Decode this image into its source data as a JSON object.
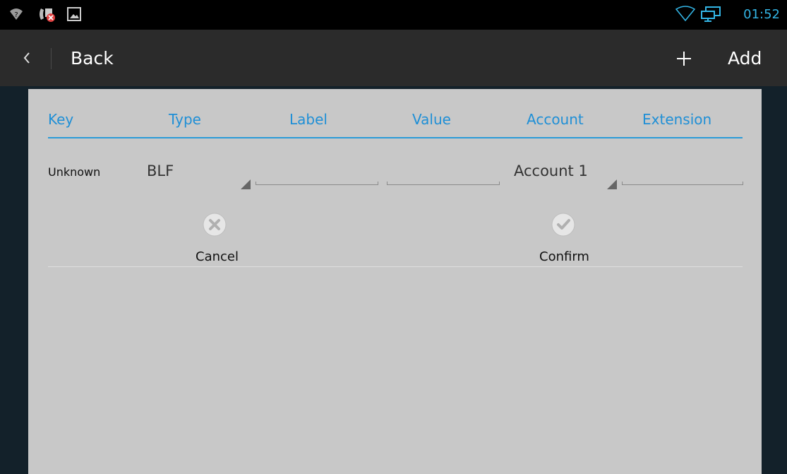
{
  "status_bar": {
    "time": "01:52"
  },
  "action_bar": {
    "back_label": "Back",
    "add_label": "Add"
  },
  "tabs": [
    "Key",
    "Type",
    "Label",
    "Value",
    "Account",
    "Extension"
  ],
  "row": {
    "key": "Unknown",
    "type": "BLF",
    "label_value": "",
    "value_value": "",
    "account": "Account 1",
    "extension_value": ""
  },
  "buttons": {
    "cancel_label": "Cancel",
    "confirm_label": "Confirm"
  },
  "colors": {
    "accent": "#1f8fd6",
    "panel_bg": "#c8c8c8",
    "action_bar_bg": "#2b2b2b",
    "status_bar_bg": "#000000"
  }
}
